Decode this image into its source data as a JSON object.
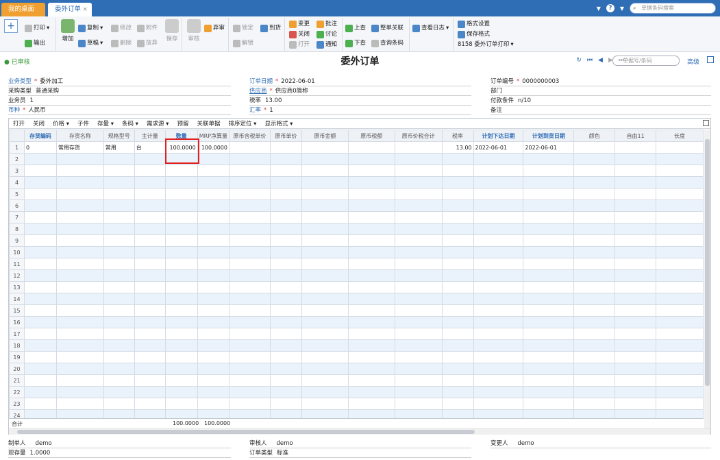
{
  "tabs": {
    "home": "我的桌面",
    "order": "委外订单",
    "close": "×"
  },
  "topsearch": {
    "placeholder": "单据条码搜索"
  },
  "toolbar": {
    "print": "打印",
    "export": "输出",
    "add": "增加",
    "copy": "复制",
    "draft": "草稿",
    "modify": "修改",
    "delete": "删除",
    "attach": "附件",
    "discard": "放弃",
    "save": "保存",
    "review": "审核",
    "abandon": "弃审",
    "lock": "锁定",
    "unlock": "解锁",
    "arrival": "到货",
    "change": "变更",
    "close": "关闭",
    "open": "打开",
    "batch_note": "批注",
    "discuss": "讨论",
    "notify": "通知",
    "prev": "上查",
    "next": "下查",
    "link": "整单关联",
    "query_barcode": "查询条码",
    "view_log": "查看日志",
    "format_settings": "格式设置",
    "save_format": "保存格式",
    "print_template": "8158 委外订单打印"
  },
  "status": {
    "badge": "已审核",
    "title": "委外订单",
    "doc_search_placeholder": "单据号/条码",
    "advanced": "高级"
  },
  "header": {
    "biz_type_label": "业务类型",
    "biz_type": "委外加工",
    "purchase_type_label": "采购类型",
    "purchase_type": "普通采购",
    "salesman_label": "业务员",
    "salesman": "1",
    "currency_label": "币种",
    "currency": "人民币",
    "order_date_label": "订单日期",
    "order_date": "2022-06-01",
    "supplier_label": "供应商",
    "supplier": "供应商0简称",
    "tax_rate_label": "税率",
    "tax_rate": "13.00",
    "exchange_rate_label": "汇率",
    "exchange_rate": "1",
    "order_no_label": "订单编号",
    "order_no": "0000000003",
    "department_label": "部门",
    "payment_label": "付款条件",
    "payment": "n/10",
    "remark_label": "备注"
  },
  "grid_toolbar": [
    "打开",
    "关闭",
    "价格 ▾",
    "子件",
    "存量 ▾",
    "条码 ▾",
    "需求源 ▾",
    "预留",
    "关联单据",
    "排序定位 ▾",
    "显示格式 ▾"
  ],
  "columns": [
    "",
    "存货编码",
    "存货名称",
    "规格型号",
    "主计量",
    "数量",
    "MRP净算量",
    "原币含税单价",
    "原币单价",
    "原币金额",
    "原币税额",
    "原币价税合计",
    "税率",
    "计划下达日期",
    "计划到货日期",
    "颜色",
    "自由11",
    "长度"
  ],
  "rows": [
    [
      "1",
      "0",
      "常用存货",
      "常用",
      "台",
      "100.0000",
      "100.0000",
      "",
      "",
      "",
      "",
      "",
      "13.00",
      "2022-06-01",
      "2022-06-01",
      "",
      "",
      ""
    ]
  ],
  "row_count": 24,
  "summary": {
    "label": "合计",
    "qty": "100.0000",
    "mrp": "100.0000"
  },
  "footer": {
    "maker_label": "制单人",
    "maker": "demo",
    "auditor_label": "审核人",
    "auditor": "demo",
    "changer_label": "变更人",
    "changer": "demo",
    "stock_label": "现存量",
    "stock": "1.0000",
    "order_type_label": "订单类型",
    "order_type": "标准"
  }
}
